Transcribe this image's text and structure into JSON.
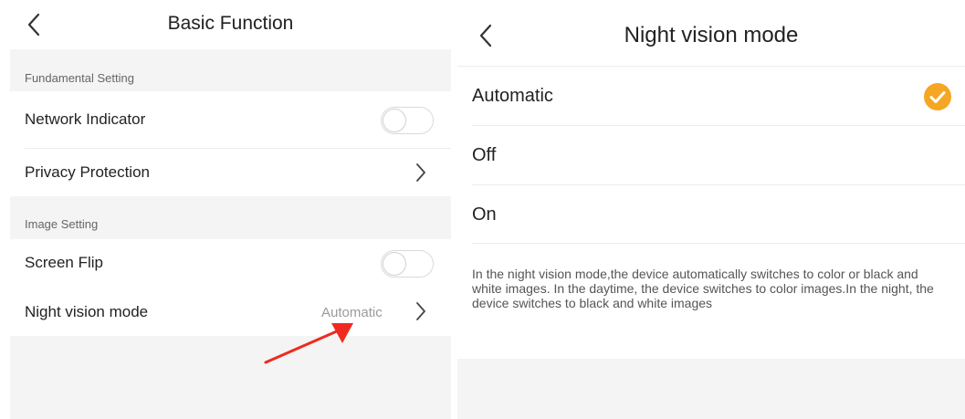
{
  "left": {
    "title": "Basic Function",
    "sections": [
      {
        "label": "Fundamental Setting",
        "rows": [
          {
            "label": "Network Indicator",
            "control": "toggle",
            "state": "off"
          },
          {
            "label": "Privacy Protection",
            "control": "chevron"
          }
        ]
      },
      {
        "label": "Image Setting",
        "rows": [
          {
            "label": "Screen Flip",
            "control": "toggle",
            "state": "off"
          },
          {
            "label": "Night vision mode",
            "control": "chevron",
            "value": "Automatic"
          }
        ]
      }
    ],
    "icons": {
      "back": "chevron-left-icon",
      "arrow": "chevron-right-icon",
      "annotation": "red-arrow-icon"
    },
    "colors": {
      "annotation_arrow": "#ef2b1f",
      "background_gray": "#f4f4f4"
    }
  },
  "right": {
    "title": "Night vision mode",
    "options": [
      {
        "label": "Automatic",
        "selected": true
      },
      {
        "label": "Off",
        "selected": false
      },
      {
        "label": "On",
        "selected": false
      }
    ],
    "description": "In the night vision mode,the device automatically switches to color or black and white images. In the daytime, the device switches to color images.In the night, the device switches to black and white images",
    "icons": {
      "back": "chevron-left-icon",
      "selected": "check-circle-icon"
    },
    "colors": {
      "selected_check": "#f5a623"
    }
  }
}
